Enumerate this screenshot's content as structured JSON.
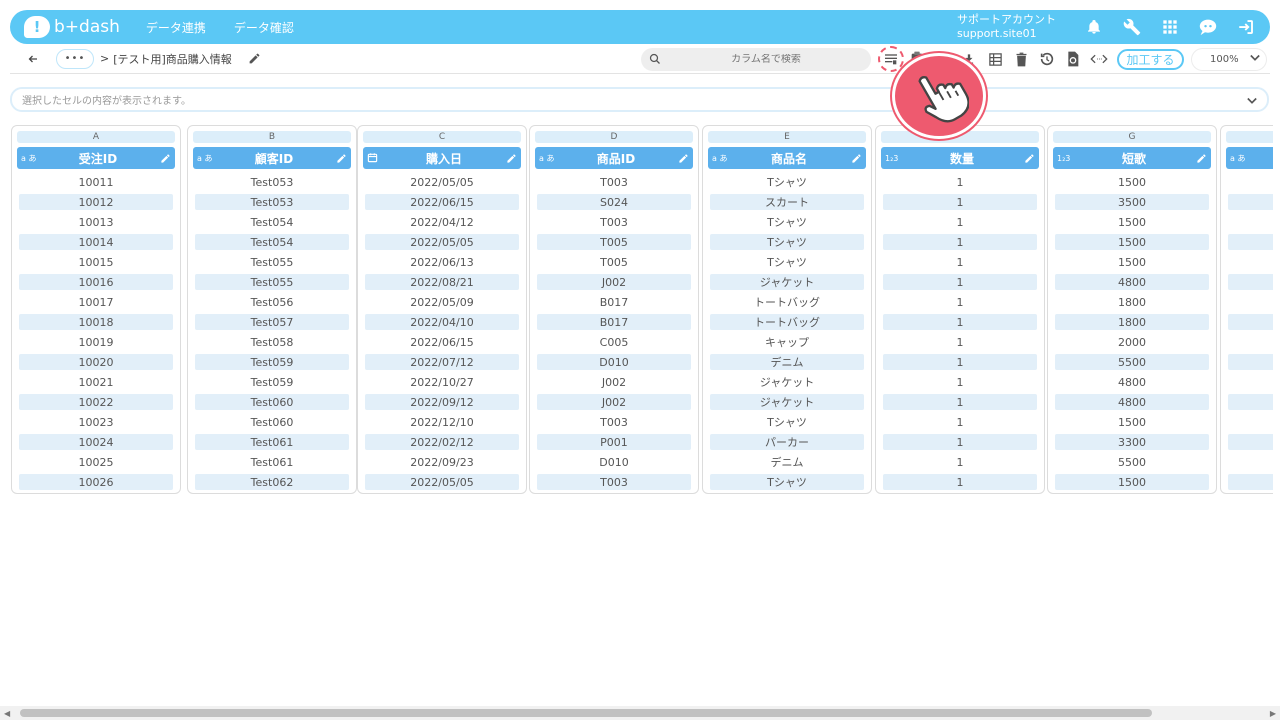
{
  "app": {
    "logo_text": "b+dash",
    "logo_mark": "!"
  },
  "nav": {
    "link1": "データ連携",
    "link2": "データ確認"
  },
  "account": {
    "name": "サポートアカウント",
    "id": "support.site01"
  },
  "toolbar": {
    "more_label": "•••",
    "breadcrumb_sep": ">",
    "breadcrumb_title": "[テスト用]商品購入情報",
    "search_placeholder": "カラム名で検索",
    "process_label": "加工する",
    "zoom_value": "100%"
  },
  "cellbar": {
    "placeholder": "選択したセルの内容が表示されます。"
  },
  "columns": [
    {
      "letter": "A",
      "type": "text",
      "type_label": "a あ",
      "name": "受注ID",
      "cells": [
        "10011",
        "10012",
        "10013",
        "10014",
        "10015",
        "10016",
        "10017",
        "10018",
        "10019",
        "10020",
        "10021",
        "10022",
        "10023",
        "10024",
        "10025",
        "10026"
      ]
    },
    {
      "letter": "B",
      "type": "text",
      "type_label": "a あ",
      "name": "顧客ID",
      "cells": [
        "Test053",
        "Test053",
        "Test054",
        "Test054",
        "Test055",
        "Test055",
        "Test056",
        "Test057",
        "Test058",
        "Test059",
        "Test059",
        "Test060",
        "Test060",
        "Test061",
        "Test061",
        "Test062"
      ]
    },
    {
      "letter": "C",
      "type": "date",
      "type_label": "",
      "name": "購入日",
      "cells": [
        "2022/05/05",
        "2022/06/15",
        "2022/04/12",
        "2022/05/05",
        "2022/06/13",
        "2022/08/21",
        "2022/05/09",
        "2022/04/10",
        "2022/06/15",
        "2022/07/12",
        "2022/10/27",
        "2022/09/12",
        "2022/12/10",
        "2022/02/12",
        "2022/09/23",
        "2022/05/05"
      ]
    },
    {
      "letter": "D",
      "type": "text",
      "type_label": "a あ",
      "name": "商品ID",
      "cells": [
        "T003",
        "S024",
        "T003",
        "T005",
        "T005",
        "J002",
        "B017",
        "B017",
        "C005",
        "D010",
        "J002",
        "J002",
        "T003",
        "P001",
        "D010",
        "T003"
      ]
    },
    {
      "letter": "E",
      "type": "text",
      "type_label": "a あ",
      "name": "商品名",
      "cells": [
        "Tシャツ",
        "スカート",
        "Tシャツ",
        "Tシャツ",
        "Tシャツ",
        "ジャケット",
        "トートバッグ",
        "トートバッグ",
        "キャップ",
        "デニム",
        "ジャケット",
        "ジャケット",
        "Tシャツ",
        "パーカー",
        "デニム",
        "Tシャツ"
      ]
    },
    {
      "letter": "",
      "type": "number",
      "type_label": "1₂3",
      "name": "数量",
      "cells": [
        "1",
        "1",
        "1",
        "1",
        "1",
        "1",
        "1",
        "1",
        "1",
        "1",
        "1",
        "1",
        "1",
        "1",
        "1",
        "1"
      ]
    },
    {
      "letter": "G",
      "type": "number",
      "type_label": "1₂3",
      "name": "短歌",
      "cells": [
        "1500",
        "3500",
        "1500",
        "1500",
        "1500",
        "4800",
        "1800",
        "1800",
        "2000",
        "5500",
        "4800",
        "4800",
        "1500",
        "3300",
        "5500",
        "1500"
      ]
    },
    {
      "letter": "",
      "type": "text",
      "type_label": "a あ",
      "name": "",
      "cells": [
        "",
        "",
        "",
        "",
        "",
        "",
        "",
        "",
        "",
        "",
        "",
        "",
        "",
        "",
        "",
        ""
      ]
    }
  ],
  "colors": {
    "brand": "#5bc8f5",
    "header": "#5cb0ec",
    "highlight": "#ee5a6f",
    "row_alt": "#e2eff9"
  },
  "icons": [
    "bell-icon",
    "wrench-icon",
    "apps-grid-icon",
    "support-chat-icon",
    "logout-icon"
  ]
}
